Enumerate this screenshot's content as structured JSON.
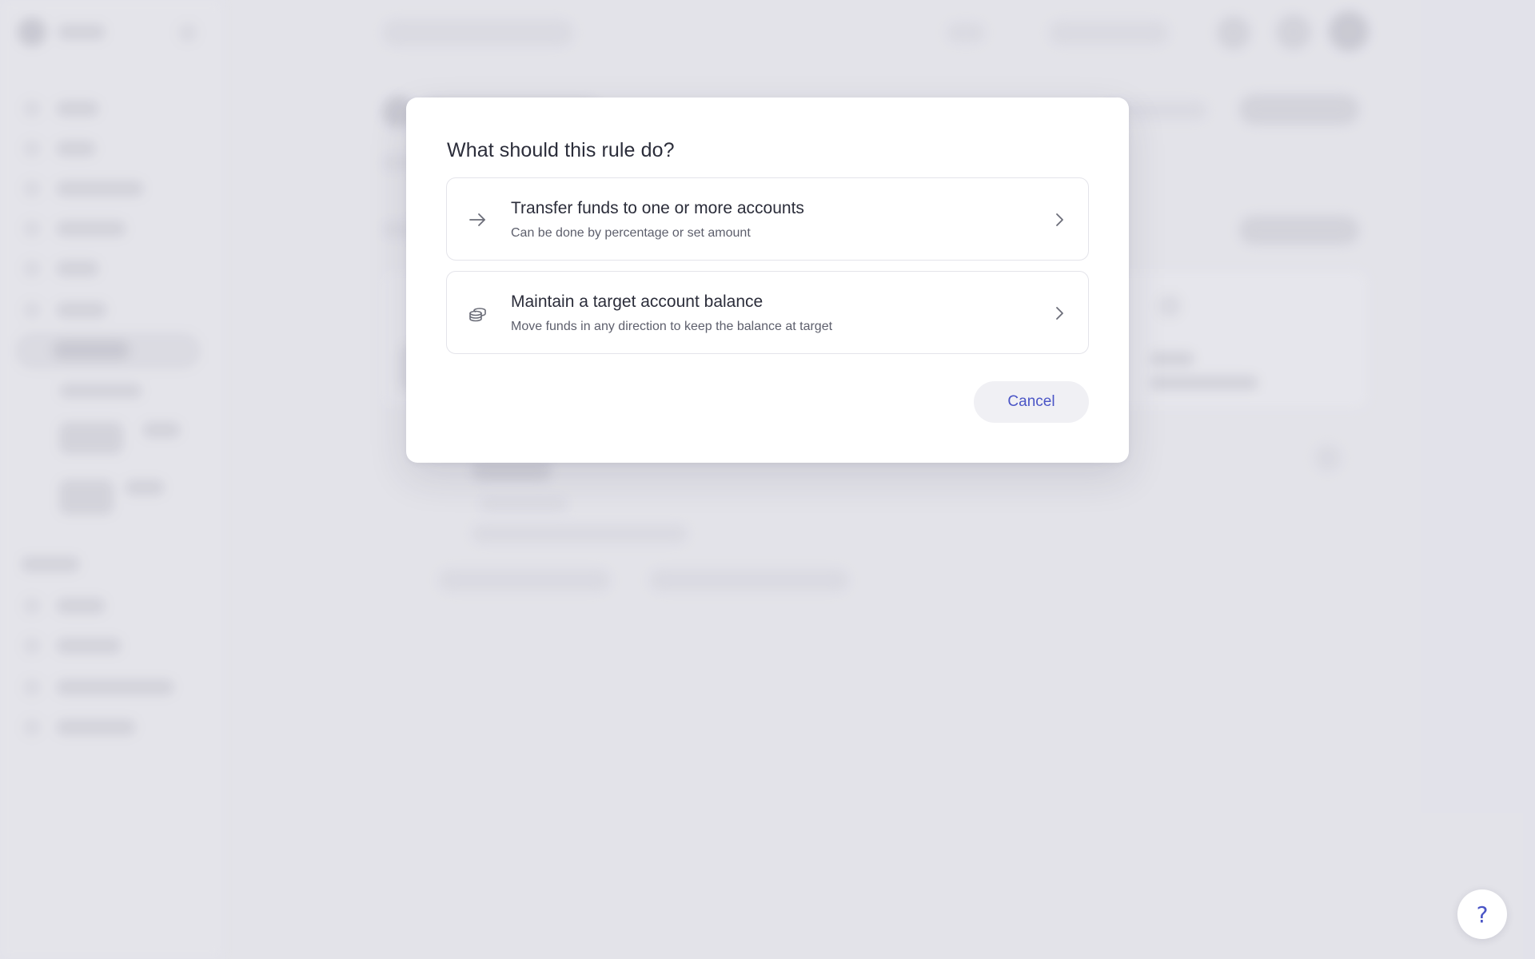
{
  "dialog": {
    "title": "What should this rule do?",
    "options": [
      {
        "title": "Transfer funds to one or more accounts",
        "subtitle": "Can be done by percentage or set amount",
        "icon": "arrow-right-icon"
      },
      {
        "title": "Maintain a target account balance",
        "subtitle": "Move funds in any direction to keep the balance at target",
        "icon": "coins-stack-icon"
      }
    ],
    "cancel_label": "Cancel"
  },
  "help": {
    "label": "?",
    "icon": "help-icon"
  },
  "colors": {
    "accent": "#4a55c6",
    "backdrop": "#e3e3ea",
    "modal_bg": "#ffffff"
  }
}
